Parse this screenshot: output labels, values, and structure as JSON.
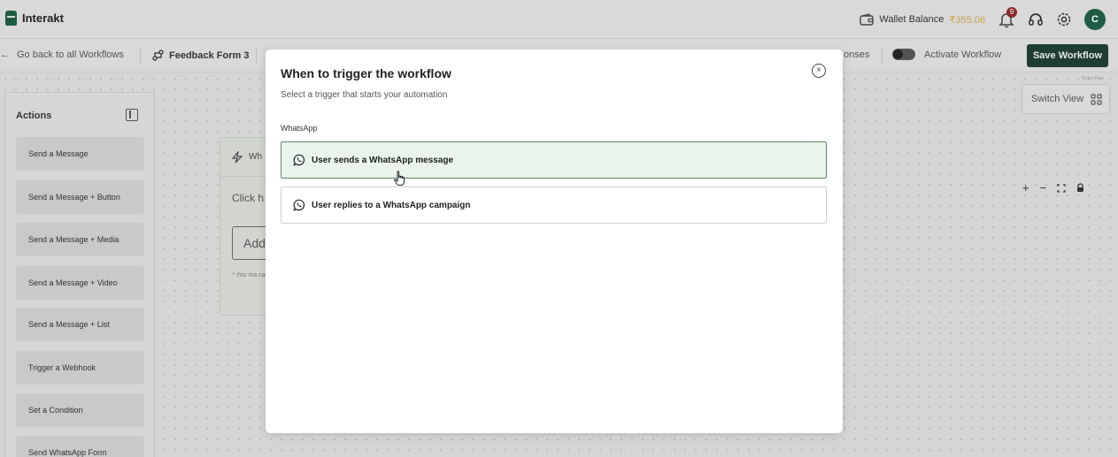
{
  "header": {
    "brand": "Interakt",
    "wallet_label": "Wallet Balance",
    "wallet_amount": "₹355.06",
    "notifications_count": "9",
    "avatar_initial": "C"
  },
  "subbar": {
    "back_label": "Go back to all Workflows",
    "workflow_name": "Feedback Form 3",
    "responses_label": "onses",
    "activate_label": "Activate Workflow",
    "save_label": "Save Workflow"
  },
  "actions_panel": {
    "title": "Actions",
    "items": [
      {
        "label": "Send a Message"
      },
      {
        "label": "Send a Message + Button"
      },
      {
        "label": "Send a Message + Media"
      },
      {
        "label": "Send a Message + Video"
      },
      {
        "label": "Send a Message + List"
      },
      {
        "label": "Trigger a Webhook"
      },
      {
        "label": "Set a Condition"
      },
      {
        "label": "Send WhatsApp Form"
      }
    ]
  },
  "trigger_card": {
    "title": "Wh",
    "text": "Click h your a",
    "add_label": "Add",
    "note": "* You ma campaign separate"
  },
  "canvas": {
    "switch_view_label": "Switch View",
    "react_flow_label": "React Flow"
  },
  "modal": {
    "title": "When to trigger the workflow",
    "subtitle": "Select a trigger that starts your automation",
    "section": "WhatsApp",
    "options": [
      {
        "label": "User sends a WhatsApp message",
        "selected": true
      },
      {
        "label": "User replies to a WhatsApp campaign",
        "selected": false
      }
    ]
  },
  "colors": {
    "brand_green": "#1f5c44",
    "save_button": "#1f3e33",
    "selected_bg": "#e9f4ec",
    "selected_border": "#5f8a6c",
    "wallet_amount": "#c9a24a"
  }
}
